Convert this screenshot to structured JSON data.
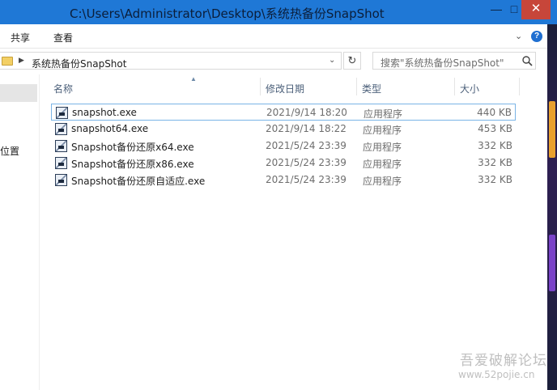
{
  "window": {
    "title": "C:\\Users\\Administrator\\Desktop\\系统热备份SnapShot",
    "minimize_glyph": "—",
    "maximize_glyph": "□",
    "close_glyph": "✕"
  },
  "ribbon": {
    "tabs": [
      "共享",
      "查看"
    ],
    "help_glyph": "?"
  },
  "address": {
    "breadcrumb": "系统热备份SnapShot",
    "search_placeholder": "搜索\"系统热备份SnapShot\""
  },
  "nav": {
    "partial_label": "位置"
  },
  "columns": [
    "名称",
    "修改日期",
    "类型",
    "大小"
  ],
  "files": [
    {
      "name": "snapshot.exe",
      "date": "2021/9/14 18:20",
      "type": "应用程序",
      "size": "440 KB",
      "selected": true
    },
    {
      "name": "snapshot64.exe",
      "date": "2021/9/14 18:22",
      "type": "应用程序",
      "size": "453 KB",
      "selected": false
    },
    {
      "name": "Snapshot备份还原x64.exe",
      "date": "2021/5/24 23:39",
      "type": "应用程序",
      "size": "332 KB",
      "selected": false
    },
    {
      "name": "Snapshot备份还原x86.exe",
      "date": "2021/5/24 23:39",
      "type": "应用程序",
      "size": "332 KB",
      "selected": false
    },
    {
      "name": "Snapshot备份还原自适应.exe",
      "date": "2021/5/24 23:39",
      "type": "应用程序",
      "size": "332 KB",
      "selected": false
    }
  ],
  "watermark": {
    "line1": "吾爱破解论坛",
    "line2": "www.52pojie.cn"
  },
  "colors": {
    "titlebar": "#1f78d6",
    "close_button": "#c7463a",
    "selection_border": "#7ab4e6",
    "column_header_text": "#4c607a"
  },
  "icons": {
    "folder": "folder-icon",
    "refresh": "refresh-icon",
    "search": "search-icon",
    "help": "help-icon",
    "file": "exe-file-icon"
  }
}
